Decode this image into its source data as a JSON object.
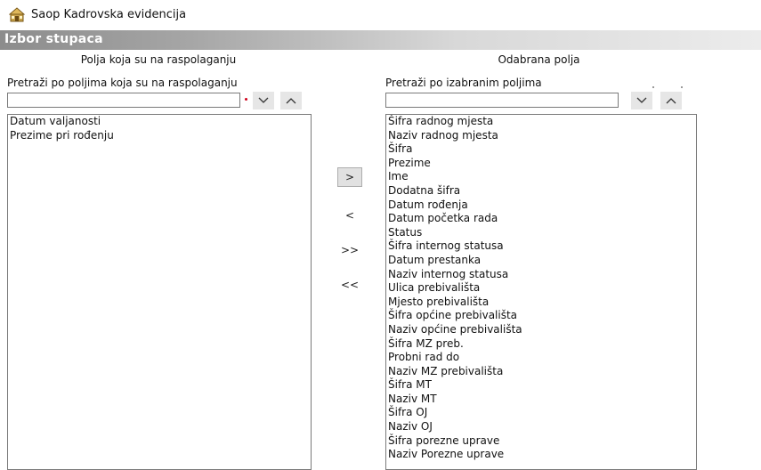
{
  "window": {
    "title": "Saop Kadrovska evidencija",
    "icon": "app-icon"
  },
  "section": {
    "title": "Izbor stupaca"
  },
  "available": {
    "header": "Polja koja su na raspolaganju",
    "search_label": "Pretraži po poljima koja su na raspolaganju",
    "search_value": "",
    "items": [
      "Datum valjanosti",
      "Prezime pri rođenju"
    ]
  },
  "selected": {
    "header": "Odabrana polja",
    "search_label": "Pretraži po izabranim poljima",
    "search_value": "",
    "items": [
      "Šifra radnog mjesta",
      "Naziv radnog mjesta",
      "Šifra",
      "Prezime",
      "Ime",
      "Dodatna šifra",
      "Datum rođenja",
      "Datum početka rada",
      "Status",
      "Šifra internog statusa",
      "Datum prestanka",
      "Naziv internog statusa",
      "Ulica prebivališta",
      "Mjesto prebivališta",
      "Šifra općine prebivališta",
      "Naziv općine prebivališta",
      "Šifra MZ preb.",
      "Probni rad do",
      "Naziv MZ prebivališta",
      "Šifra MT",
      "Naziv MT",
      "Šifra OJ",
      "Naziv OJ",
      "Šifra porezne uprave",
      "Naziv Porezne uprave"
    ]
  },
  "transfer": {
    "add": ">",
    "remove": "<",
    "add_all": ">>",
    "remove_all": "<<"
  },
  "icons": {
    "down": "chevron-down-icon",
    "up": "chevron-up-icon"
  }
}
